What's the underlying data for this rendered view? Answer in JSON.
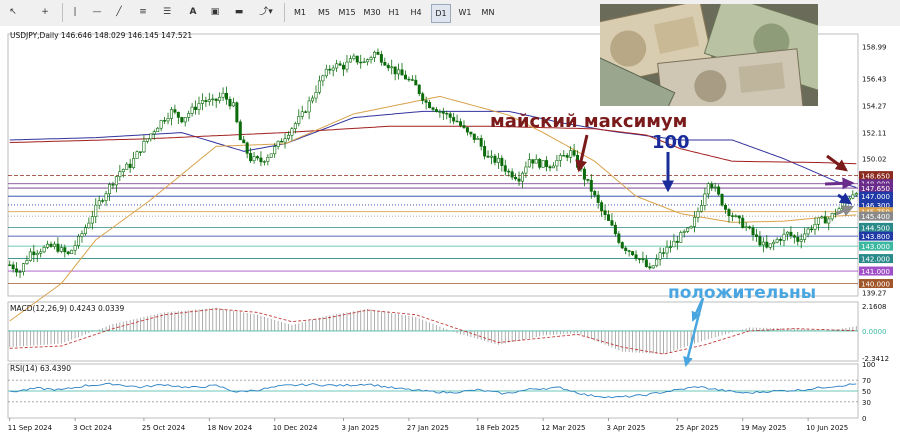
{
  "toolbar": {
    "timeframes": [
      "M1",
      "M5",
      "M15",
      "M30",
      "H1",
      "H4",
      "D1",
      "W1",
      "MN"
    ],
    "active_timeframe": "D1"
  },
  "header": {
    "symbol_line": "USDJPY,Daily  146.646 148.029 146.145 147.521"
  },
  "annotations": {
    "may_max": "майский максимум",
    "hundred": "100",
    "positive": "положительны"
  },
  "colors": {
    "candle": "#0b6b0b",
    "ma_blue": "#33339e",
    "ma_red": "#a21e1e",
    "ma_orange": "#d9a24b",
    "annotation_text": "#7a1a1a",
    "hundred_text": "#1a2c9a",
    "positive_text": "#4aa6e0"
  },
  "chart_data": [
    {
      "type": "candlestick",
      "symbol": "USDJPY",
      "timeframe": "Daily",
      "ohlc_last": {
        "open": 146.646,
        "high": 148.029,
        "low": 146.145,
        "close": 147.521
      },
      "x_labels": [
        "11 Sep 2024",
        "3 Oct 2024",
        "25 Oct 2024",
        "18 Nov 2024",
        "10 Dec 2024",
        "3 Jan 2025",
        "27 Jan 2025",
        "18 Feb 2025",
        "12 Mar 2025",
        "3 Apr 2025",
        "25 Apr 2025",
        "19 May 2025",
        "10 Jun 2025"
      ],
      "y_ticks": [
        158.99,
        156.43,
        154.27,
        152.11,
        150.02,
        139.27
      ],
      "ylim": [
        139.0,
        160.0
      ],
      "close_path": [
        [
          0,
          141.5
        ],
        [
          3,
          141.0
        ],
        [
          6,
          142.5
        ],
        [
          10,
          142.8
        ],
        [
          13,
          143.0
        ],
        [
          17,
          142.3
        ],
        [
          20,
          143.5
        ],
        [
          23,
          145.0
        ],
        [
          26,
          146.5
        ],
        [
          29,
          147.8
        ],
        [
          32,
          149.0
        ],
        [
          35,
          149.5
        ],
        [
          38,
          150.8
        ],
        [
          41,
          152.0
        ],
        [
          44,
          153.0
        ],
        [
          47,
          153.8
        ],
        [
          50,
          153.2
        ],
        [
          53,
          153.9
        ],
        [
          56,
          154.7
        ],
        [
          59,
          154.5
        ],
        [
          62,
          155.1
        ],
        [
          65,
          154.2
        ],
        [
          67,
          151.5
        ],
        [
          70,
          150.0
        ],
        [
          73,
          149.8
        ],
        [
          76,
          150.5
        ],
        [
          79,
          151.5
        ],
        [
          82,
          152.5
        ],
        [
          85,
          153.5
        ],
        [
          88,
          155.0
        ],
        [
          91,
          156.6
        ],
        [
          94,
          157.5
        ],
        [
          97,
          157.4
        ],
        [
          100,
          158.0
        ],
        [
          103,
          157.7
        ],
        [
          106,
          158.5
        ],
        [
          109,
          157.8
        ],
        [
          112,
          157.0
        ],
        [
          115,
          156.5
        ],
        [
          118,
          155.8
        ],
        [
          121,
          154.5
        ],
        [
          124,
          154.0
        ],
        [
          127,
          153.5
        ],
        [
          130,
          153.0
        ],
        [
          133,
          152.0
        ],
        [
          136,
          151.5
        ],
        [
          139,
          150.0
        ],
        [
          142,
          149.8
        ],
        [
          145,
          148.9
        ],
        [
          148,
          148.5
        ],
        [
          151,
          150.0
        ],
        [
          154,
          149.6
        ],
        [
          157,
          149.5
        ],
        [
          160,
          150.0
        ],
        [
          163,
          150.5
        ],
        [
          166,
          149.0
        ],
        [
          169,
          147.5
        ],
        [
          172,
          145.8
        ],
        [
          175,
          144.5
        ],
        [
          178,
          143.0
        ],
        [
          181,
          142.5
        ],
        [
          184,
          141.7
        ],
        [
          186,
          141.0
        ],
        [
          189,
          142.3
        ],
        [
          192,
          143.0
        ],
        [
          195,
          143.8
        ],
        [
          198,
          144.4
        ],
        [
          201,
          146.5
        ],
        [
          203,
          148.3
        ],
        [
          205,
          147.5
        ],
        [
          208,
          146.0
        ],
        [
          211,
          145.2
        ],
        [
          214,
          144.5
        ],
        [
          217,
          143.6
        ],
        [
          220,
          142.8
        ],
        [
          223,
          143.5
        ],
        [
          226,
          144.0
        ],
        [
          229,
          143.5
        ],
        [
          232,
          144.3
        ],
        [
          235,
          145.0
        ],
        [
          238,
          145.2
        ],
        [
          241,
          146.0
        ],
        [
          244,
          147.0
        ],
        [
          246,
          147.5
        ]
      ],
      "moving_averages": [
        {
          "color": "blue",
          "points": [
            [
              0,
              151.5
            ],
            [
              25,
              151.7
            ],
            [
              50,
              152.1
            ],
            [
              68,
              150.6
            ],
            [
              80,
              151.2
            ],
            [
              100,
              153.3
            ],
            [
              120,
              153.8
            ],
            [
              145,
              153.8
            ],
            [
              160,
              152.9
            ],
            [
              175,
              152.2
            ],
            [
              195,
              151.5
            ],
            [
              210,
              151.5
            ],
            [
              225,
              150.0
            ],
            [
              240,
              148.2
            ],
            [
              246,
              147.7
            ]
          ]
        },
        {
          "color": "red",
          "points": [
            [
              0,
              151.3
            ],
            [
              40,
              151.6
            ],
            [
              80,
              152.1
            ],
            [
              110,
              152.6
            ],
            [
              140,
              152.6
            ],
            [
              170,
              152.4
            ],
            [
              185,
              151.9
            ],
            [
              195,
              150.8
            ],
            [
              210,
              149.8
            ],
            [
              235,
              149.7
            ],
            [
              246,
              149.6
            ]
          ]
        },
        {
          "color": "orange",
          "points": [
            [
              0,
              137.0
            ],
            [
              15,
              140.0
            ],
            [
              25,
              143.5
            ],
            [
              40,
              146.5
            ],
            [
              60,
              151.0
            ],
            [
              80,
              151.2
            ],
            [
              100,
              153.6
            ],
            [
              125,
              155.0
            ],
            [
              145,
              153.5
            ],
            [
              155,
              152.1
            ],
            [
              170,
              149.8
            ],
            [
              182,
              147.0
            ],
            [
              195,
              145.6
            ],
            [
              210,
              144.9
            ],
            [
              225,
              145.0
            ],
            [
              240,
              145.4
            ],
            [
              246,
              145.5
            ]
          ]
        }
      ],
      "levels": [
        {
          "value": 148.65,
          "label": "148.650",
          "color": "#8b2a1e",
          "style": "dashed"
        },
        {
          "value": 148.0,
          "label": "148.000",
          "color": "#6a2c8a",
          "style": "solid"
        },
        {
          "value": 147.65,
          "label": "147.650",
          "color": "#6a2c8a",
          "style": "solid"
        },
        {
          "value": 147.0,
          "label": "147.000",
          "color": "#1f3aa6",
          "style": "solid"
        },
        {
          "value": 146.3,
          "label": "146.300",
          "color": "#1f3aa6",
          "style": "dotted"
        },
        {
          "value": 145.759,
          "label": "145.759",
          "color": "#d9a24b",
          "style": "solid"
        },
        {
          "value": 145.4,
          "label": "145.400",
          "color": "#8a8a8a",
          "style": "dotted"
        },
        {
          "value": 144.5,
          "label": "144.500",
          "color": "#2a8a8a",
          "style": "solid"
        },
        {
          "value": 143.8,
          "label": "143.800",
          "color": "#1f3aa6",
          "style": "solid"
        },
        {
          "value": 143.0,
          "label": "143.000",
          "color": "#3cb8a0",
          "style": "solid"
        },
        {
          "value": 142.0,
          "label": "142.000",
          "color": "#2a8a8a",
          "style": "solid"
        },
        {
          "value": 141.0,
          "label": "141.000",
          "color": "#a050c8",
          "style": "solid"
        },
        {
          "value": 140.0,
          "label": "140.000",
          "color": "#a0562a",
          "style": "solid"
        }
      ]
    },
    {
      "type": "histogram",
      "title": "MACD(12,26,9) 0.4243 0.0339",
      "y_ticks": [
        2.1608,
        0.0,
        -2.3412
      ],
      "ylim": [
        -2.6,
        2.5
      ],
      "histogram": [
        [
          0,
          -1.4
        ],
        [
          15,
          -1.1
        ],
        [
          30,
          0.6
        ],
        [
          45,
          1.6
        ],
        [
          60,
          2.0
        ],
        [
          72,
          1.4
        ],
        [
          82,
          0.5
        ],
        [
          92,
          1.3
        ],
        [
          104,
          1.9
        ],
        [
          118,
          1.2
        ],
        [
          130,
          -0.2
        ],
        [
          142,
          -1.2
        ],
        [
          155,
          -0.4
        ],
        [
          165,
          -0.2
        ],
        [
          178,
          -1.8
        ],
        [
          190,
          -2.0
        ],
        [
          202,
          -0.8
        ],
        [
          215,
          0.3
        ],
        [
          228,
          0.2
        ],
        [
          238,
          0.0
        ],
        [
          246,
          0.42
        ]
      ],
      "signal": [
        [
          0,
          -1.5
        ],
        [
          15,
          -1.3
        ],
        [
          30,
          0.2
        ],
        [
          45,
          1.4
        ],
        [
          60,
          1.9
        ],
        [
          72,
          1.6
        ],
        [
          82,
          0.8
        ],
        [
          92,
          1.1
        ],
        [
          104,
          1.8
        ],
        [
          118,
          1.4
        ],
        [
          130,
          0.2
        ],
        [
          142,
          -1.0
        ],
        [
          155,
          -0.6
        ],
        [
          165,
          -0.3
        ],
        [
          178,
          -1.4
        ],
        [
          190,
          -2.0
        ],
        [
          202,
          -1.2
        ],
        [
          215,
          0.0
        ],
        [
          228,
          0.2
        ],
        [
          238,
          0.1
        ],
        [
          246,
          0.03
        ]
      ]
    },
    {
      "type": "line",
      "title": "RSI(14) 63.4390",
      "y_ticks": [
        100,
        70,
        50,
        30,
        0
      ],
      "ylim": [
        0,
        100
      ],
      "levels": [
        70,
        50,
        30
      ],
      "series": [
        {
          "points": [
            [
              0,
              48
            ],
            [
              8,
              55
            ],
            [
              15,
              52
            ],
            [
              22,
              60
            ],
            [
              30,
              63
            ],
            [
              38,
              57
            ],
            [
              45,
              62
            ],
            [
              52,
              56
            ],
            [
              60,
              60
            ],
            [
              66,
              48
            ],
            [
              72,
              52
            ],
            [
              80,
              60
            ],
            [
              88,
              62
            ],
            [
              96,
              60
            ],
            [
              104,
              63
            ],
            [
              112,
              55
            ],
            [
              120,
              50
            ],
            [
              128,
              47
            ],
            [
              136,
              52
            ],
            [
              144,
              45
            ],
            [
              152,
              54
            ],
            [
              160,
              56
            ],
            [
              168,
              42
            ],
            [
              176,
              38
            ],
            [
              184,
              42
            ],
            [
              192,
              50
            ],
            [
              200,
              58
            ],
            [
              206,
              52
            ],
            [
              214,
              46
            ],
            [
              222,
              50
            ],
            [
              230,
              52
            ],
            [
              238,
              58
            ],
            [
              246,
              63
            ]
          ]
        }
      ]
    }
  ]
}
